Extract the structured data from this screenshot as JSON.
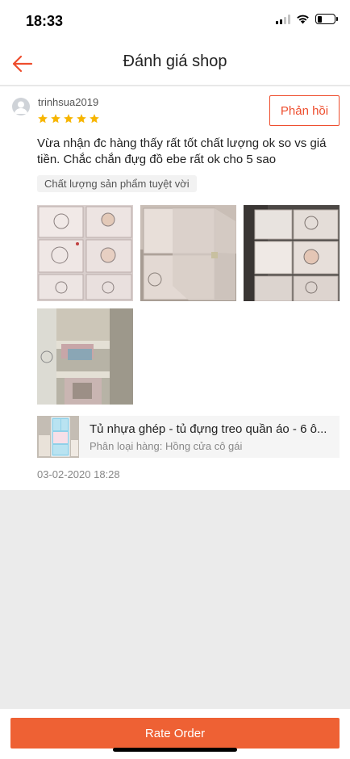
{
  "status_bar": {
    "time": "18:33",
    "signal_bars": 4,
    "signal_active": 2,
    "battery_level": 0.25
  },
  "header": {
    "title": "Đánh giá shop",
    "back_icon": "back-arrow-icon"
  },
  "colors": {
    "accent": "#ee4d2d",
    "button_bg": "#ee6134",
    "star": "#f7b500",
    "page_bg": "#ebebeb"
  },
  "review": {
    "username": "trinhsua2019",
    "rating": 5,
    "reply_label": "Phản hồi",
    "text": "Vừa nhận đc hàng thấy rất tốt chất lượng ok so vs giá tiền. Chắc chắn đựg đồ ebe rất ok cho 5 sao",
    "tag": "Chất lượng sản phẩm tuyệt vời",
    "photos": [
      "photo-1",
      "photo-2",
      "photo-3",
      "photo-4"
    ],
    "product": {
      "name": "Tủ nhựa ghép - tủ đựng treo quần áo - 6 ô...",
      "variant": "Phân loại hàng: Hồng cửa cô gái"
    },
    "date": "03-02-2020 18:28"
  },
  "footer": {
    "rate_button": "Rate Order"
  }
}
